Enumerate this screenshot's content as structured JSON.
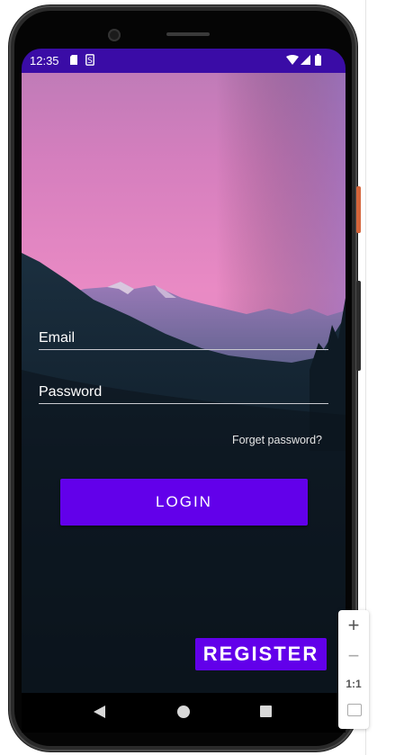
{
  "status_bar": {
    "time": "12:35",
    "background": "#3a0ca6"
  },
  "login": {
    "email_placeholder": "Email",
    "password_placeholder": "Password",
    "forgot_label": "Forget password?",
    "login_label": "LOGIN",
    "register_label": "REGISTER",
    "accent": "#6200ea"
  },
  "zoom_panel": {
    "zoom_in": "+",
    "zoom_out": "−",
    "actual_size": "1:1"
  },
  "icons": [
    "sd-card-icon",
    "s-notification-icon",
    "wifi-icon",
    "signal-icon",
    "battery-icon",
    "back-icon",
    "home-icon",
    "recents-icon",
    "zoom-in-icon",
    "zoom-out-icon",
    "fit-screen-icon"
  ]
}
